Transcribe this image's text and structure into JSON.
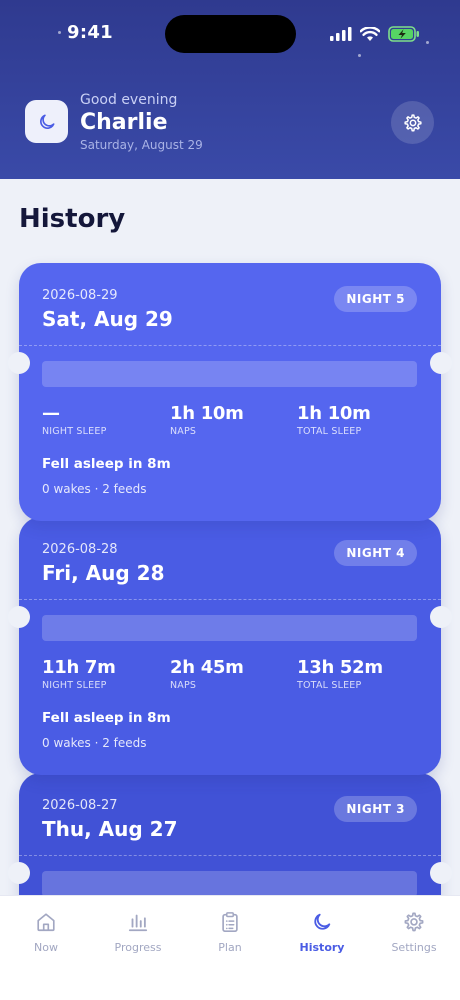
{
  "status_bar": {
    "time": "9:41"
  },
  "header": {
    "greeting": "Good evening",
    "name": "Charlie",
    "date": "Saturday, August 29"
  },
  "page_title": "History",
  "history": [
    {
      "iso_date": "2026-08-29",
      "day_label": "Sat, Aug 29",
      "night_badge": "NIGHT 5",
      "night_sleep": "—",
      "naps": "1h 10m",
      "total_sleep": "1h 10m",
      "latency": "Fell asleep in 8m",
      "events": "0 wakes · 2 feeds"
    },
    {
      "iso_date": "2026-08-28",
      "day_label": "Fri, Aug 28",
      "night_badge": "NIGHT 4",
      "night_sleep": "11h 7m",
      "naps": "2h 45m",
      "total_sleep": "13h 52m",
      "latency": "Fell asleep in 8m",
      "events": "0 wakes · 2 feeds"
    },
    {
      "iso_date": "2026-08-27",
      "day_label": "Thu, Aug 27",
      "night_badge": "NIGHT 3"
    }
  ],
  "stat_labels": {
    "night_sleep": "NIGHT SLEEP",
    "naps": "NAPS",
    "total_sleep": "TOTAL SLEEP"
  },
  "tabs": [
    {
      "label": "Now",
      "icon": "home-icon"
    },
    {
      "label": "Progress",
      "icon": "bar-chart-icon"
    },
    {
      "label": "Plan",
      "icon": "clipboard-icon"
    },
    {
      "label": "History",
      "icon": "moon-icon",
      "active": true
    },
    {
      "label": "Settings",
      "icon": "gear-icon"
    }
  ],
  "colors": {
    "header_bg": "#2f3a8f",
    "card_1": "#5566ef",
    "card_2": "#4a5ce4",
    "card_3": "#4152d6",
    "active_tab": "#4a5ce4",
    "inactive_tab": "#a2a7c2"
  }
}
